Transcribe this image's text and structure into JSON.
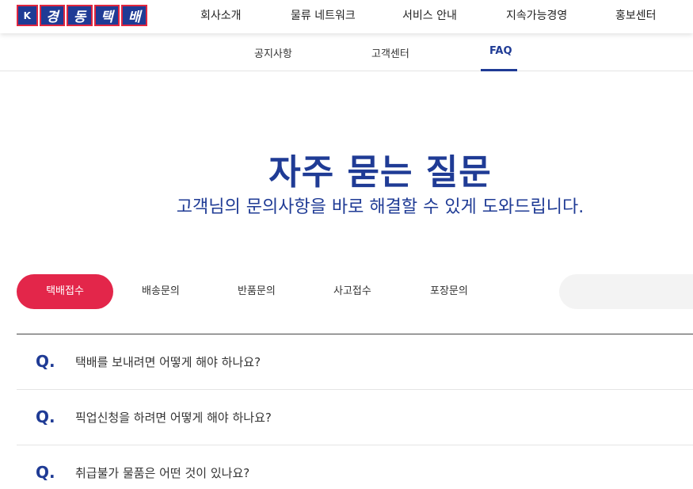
{
  "brand": {
    "emblem": "K",
    "logo_chars": [
      "경",
      "동",
      "택",
      "배"
    ],
    "primary_color": "#1f3b95",
    "accent_color": "#e3264a"
  },
  "main_nav": [
    {
      "label": "회사소개"
    },
    {
      "label": "물류 네트워크"
    },
    {
      "label": "서비스 안내"
    },
    {
      "label": "지속가능경영"
    },
    {
      "label": "홍보센터"
    }
  ],
  "sub_nav": [
    {
      "label": "공지사항",
      "active": false
    },
    {
      "label": "고객센터",
      "active": false
    },
    {
      "label": "FAQ",
      "active": true
    }
  ],
  "hero": {
    "title": "자주 묻는 질문",
    "subtitle": "고객님의 문의사항을 바로 해결할 수 있게 도와드립니다."
  },
  "categories": [
    {
      "label": "택배접수",
      "active": true
    },
    {
      "label": "배송문의",
      "active": false
    },
    {
      "label": "반품문의",
      "active": false
    },
    {
      "label": "사고접수",
      "active": false
    },
    {
      "label": "포장문의",
      "active": false
    }
  ],
  "search": {
    "placeholder": "",
    "value": ""
  },
  "faqs": [
    {
      "marker": "Q.",
      "question": "택배를 보내려면 어떻게 해야 하나요?"
    },
    {
      "marker": "Q.",
      "question": "픽업신청을 하려면 어떻게 해야 하나요?"
    },
    {
      "marker": "Q.",
      "question": "취급불가 물품은 어떤 것이 있나요?"
    }
  ]
}
